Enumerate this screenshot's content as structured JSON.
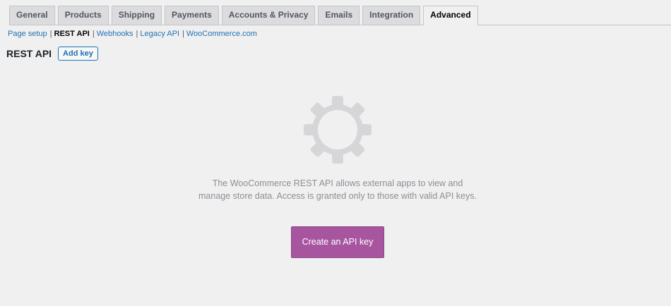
{
  "tabs": [
    {
      "label": "General",
      "active": false
    },
    {
      "label": "Products",
      "active": false
    },
    {
      "label": "Shipping",
      "active": false
    },
    {
      "label": "Payments",
      "active": false
    },
    {
      "label": "Accounts & Privacy",
      "active": false
    },
    {
      "label": "Emails",
      "active": false
    },
    {
      "label": "Integration",
      "active": false
    },
    {
      "label": "Advanced",
      "active": true
    }
  ],
  "sections": {
    "page_setup": "Page setup",
    "rest_api": "REST API",
    "webhooks": "Webhooks",
    "legacy_api": "Legacy API",
    "woocommerce_com": "WooCommerce.com",
    "separator": "|"
  },
  "heading": {
    "title": "REST API",
    "add_key_label": "Add key"
  },
  "blank_state": {
    "icon": "gear-icon",
    "message": "The WooCommerce REST API allows external apps to view and manage store data. Access is granted only to those with valid API keys.",
    "button_label": "Create an API key"
  },
  "colors": {
    "background": "#f0f0f1",
    "link": "#2271b1",
    "primary_button": "#a7559f",
    "gear": "#d6d6d8",
    "muted_text": "#8c8f94"
  }
}
